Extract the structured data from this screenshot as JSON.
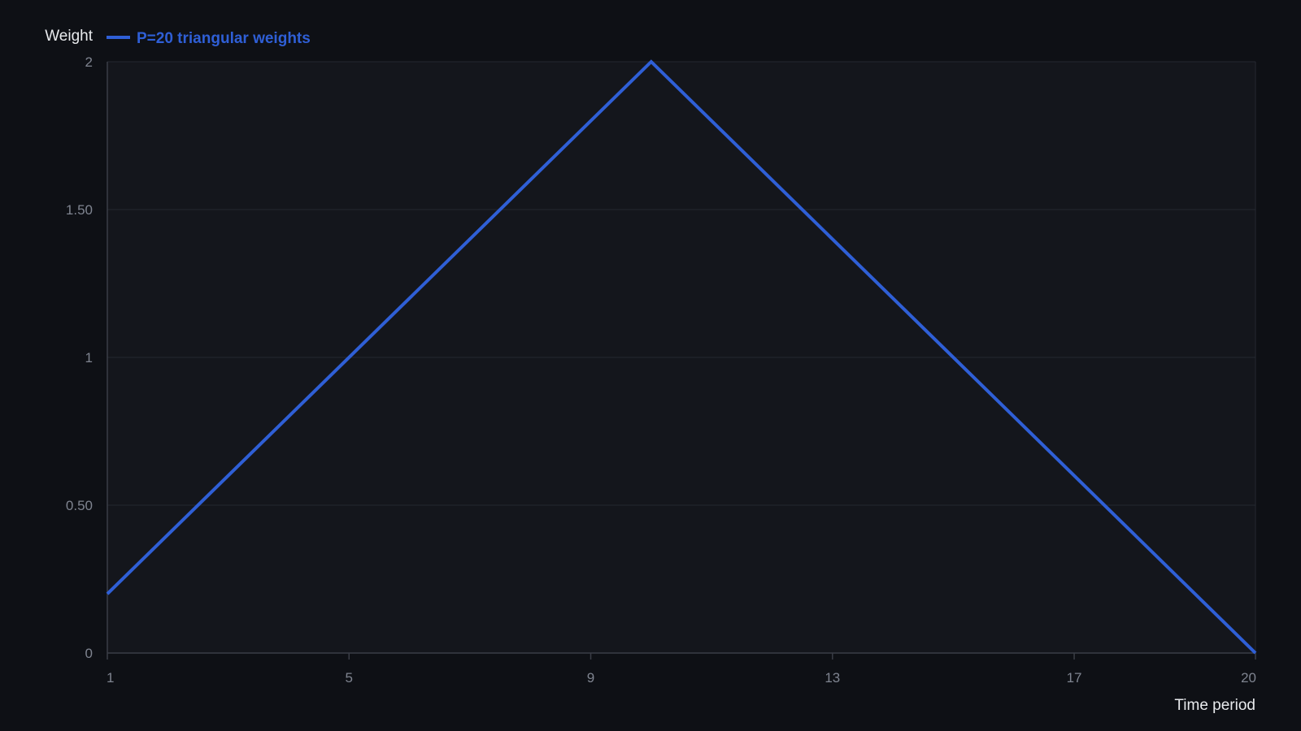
{
  "chart_data": {
    "type": "line",
    "ylabel": "Weight",
    "xlabel": "Time period",
    "x_ticks": [
      1,
      5,
      9,
      13,
      17,
      20
    ],
    "y_ticks": [
      0,
      0.5,
      1,
      1.5,
      2
    ],
    "y_tick_labels": [
      "0",
      "0.50",
      "1",
      "1.50",
      "2"
    ],
    "x_tick_labels": [
      "1",
      "5",
      "9",
      "13",
      "17",
      "20"
    ],
    "xlim": [
      1,
      20
    ],
    "ylim": [
      0,
      2
    ],
    "grid": true,
    "legend_position": "top-left",
    "series": [
      {
        "name": "P=20 triangular weights",
        "color": "#2f5fd6",
        "x": [
          1,
          10,
          20
        ],
        "y": [
          0.2,
          2,
          0
        ]
      }
    ]
  },
  "colors": {
    "background": "#0e1015",
    "plot_background": "#14161c",
    "grid": "#252831",
    "axis": "#3a3d46"
  }
}
